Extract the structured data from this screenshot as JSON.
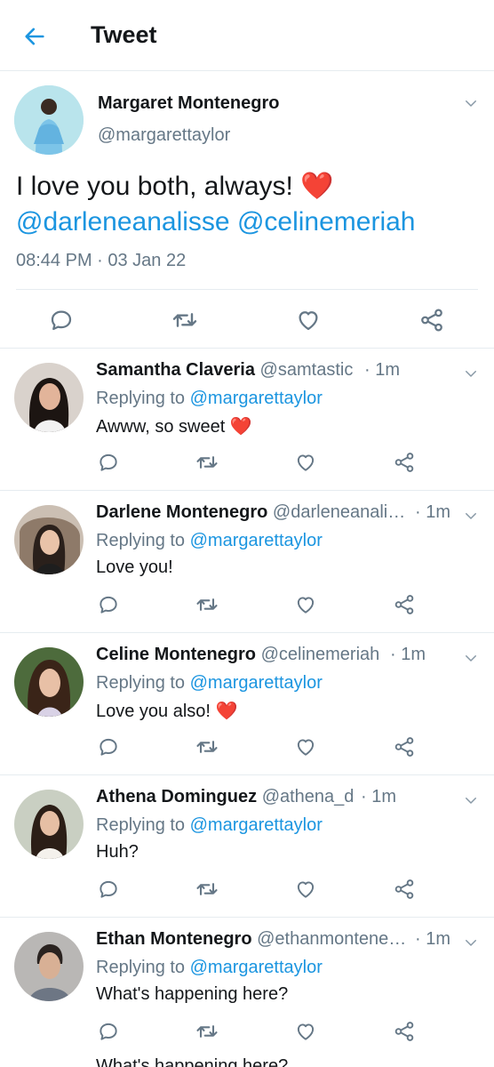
{
  "header": {
    "title": "Tweet",
    "back_icon": "arrow-left-icon",
    "accent": "#1b95e0"
  },
  "main_tweet": {
    "author_name": "Margaret Montenegro",
    "handle": "@margarettaylor",
    "text": "I love you both, always!",
    "emoji": "❤️",
    "mentions": [
      "@darleneanalisse",
      "@celinemeriah"
    ],
    "timestamp": "08:44 PM · 03 Jan 22"
  },
  "replies": [
    {
      "name": "Samantha Claveria",
      "handle": "@samtastic",
      "time": "· 1m",
      "replying_prefix": "Replying to",
      "replying_to": "@margarettaylor",
      "text": "Awww, so sweet",
      "emoji": "❤️"
    },
    {
      "name": "Darlene Montenegro",
      "handle": "@darleneanali…",
      "time": "· 1m",
      "replying_prefix": "Replying to",
      "replying_to": "@margarettaylor",
      "text": "Love you!",
      "emoji": ""
    },
    {
      "name": "Celine Montenegro",
      "handle": "@celinemeriah",
      "time": "· 1m",
      "replying_prefix": "Replying to",
      "replying_to": "@margarettaylor",
      "text": "Love you also!",
      "emoji": "❤️"
    },
    {
      "name": "Athena Dominguez",
      "handle": "@athena_d",
      "time": "· 1m",
      "replying_prefix": "Replying to",
      "replying_to": "@margarettaylor",
      "text": "Huh?",
      "emoji": ""
    },
    {
      "name": "Ethan Montenegro",
      "handle": "@ethanmontene…",
      "time": "· 1m",
      "replying_prefix": "Replying to",
      "replying_to": "@margarettaylor",
      "text": "What's happening here?",
      "emoji": ""
    }
  ],
  "bottom_peek_text": "What's happening here?",
  "icons": {
    "reply": "reply-icon",
    "retweet": "retweet-icon",
    "like": "heart-icon",
    "share": "share-icon",
    "caret": "chevron-down-icon"
  },
  "colors": {
    "text": "#14171a",
    "secondary": "#657786",
    "link": "#1b95e0",
    "heart": "#e0245e",
    "divider": "#e6ecf0"
  }
}
